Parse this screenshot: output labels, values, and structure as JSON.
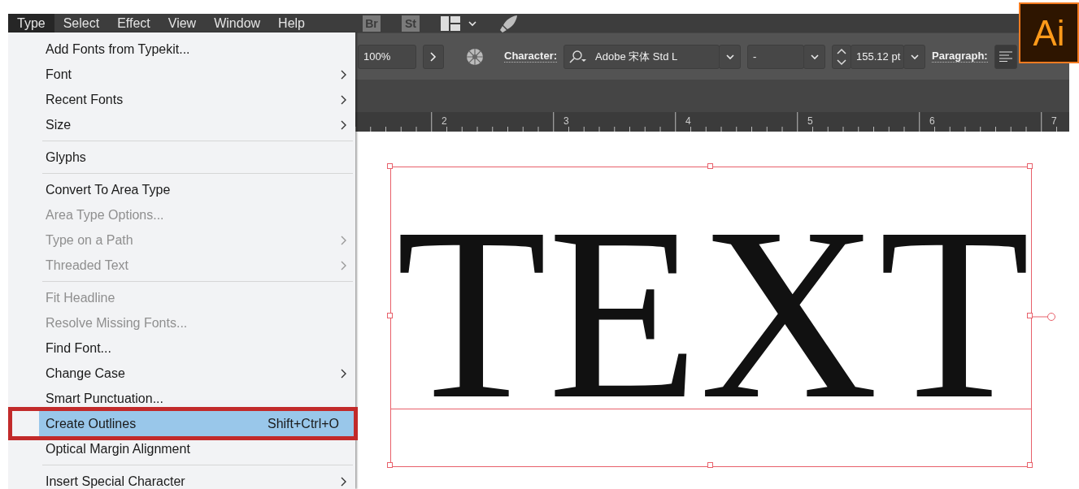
{
  "menu_bar": [
    {
      "label": "Type",
      "selected": true
    },
    {
      "label": "Select",
      "selected": false
    },
    {
      "label": "Effect",
      "selected": false
    },
    {
      "label": "View",
      "selected": false
    },
    {
      "label": "Window",
      "selected": false
    },
    {
      "label": "Help",
      "selected": false
    }
  ],
  "app_buttons": [
    "Br",
    "St"
  ],
  "app_logo": "Ai",
  "control_bar": {
    "zoom": "100%",
    "character_label": "Character:",
    "font": "Adobe 宋体 Std L",
    "style": "-",
    "size": "155.12 pt",
    "paragraph_label": "Paragraph:"
  },
  "ruler": [
    "2",
    "3",
    "4",
    "5",
    "6",
    "7"
  ],
  "type_menu": [
    {
      "kind": "item",
      "label": "Add Fonts from Typekit...",
      "disabled": false,
      "submenu": false,
      "selected": false
    },
    {
      "kind": "item",
      "label": "Font",
      "disabled": false,
      "submenu": true,
      "selected": false
    },
    {
      "kind": "item",
      "label": "Recent Fonts",
      "disabled": false,
      "submenu": true,
      "selected": false
    },
    {
      "kind": "item",
      "label": "Size",
      "disabled": false,
      "submenu": true,
      "selected": false
    },
    {
      "kind": "separator"
    },
    {
      "kind": "item",
      "label": "Glyphs",
      "disabled": false,
      "submenu": false,
      "selected": false
    },
    {
      "kind": "separator"
    },
    {
      "kind": "item",
      "label": "Convert To Area Type",
      "disabled": false,
      "submenu": false,
      "selected": false
    },
    {
      "kind": "item",
      "label": "Area Type Options...",
      "disabled": true,
      "submenu": false,
      "selected": false
    },
    {
      "kind": "item",
      "label": "Type on a Path",
      "disabled": true,
      "submenu": true,
      "selected": false
    },
    {
      "kind": "item",
      "label": "Threaded Text",
      "disabled": true,
      "submenu": true,
      "selected": false
    },
    {
      "kind": "separator"
    },
    {
      "kind": "item",
      "label": "Fit Headline",
      "disabled": true,
      "submenu": false,
      "selected": false
    },
    {
      "kind": "item",
      "label": "Resolve Missing Fonts...",
      "disabled": true,
      "submenu": false,
      "selected": false
    },
    {
      "kind": "item",
      "label": "Find Font...",
      "disabled": false,
      "submenu": false,
      "selected": false
    },
    {
      "kind": "item",
      "label": "Change Case",
      "disabled": false,
      "submenu": true,
      "selected": false
    },
    {
      "kind": "item",
      "label": "Smart Punctuation...",
      "disabled": false,
      "submenu": false,
      "selected": false
    },
    {
      "kind": "item",
      "label": "Create Outlines",
      "shortcut": "Shift+Ctrl+O",
      "disabled": false,
      "submenu": false,
      "selected": true
    },
    {
      "kind": "item",
      "label": "Optical Margin Alignment",
      "disabled": false,
      "submenu": false,
      "selected": false
    },
    {
      "kind": "separator"
    },
    {
      "kind": "item",
      "label": "Insert Special Character",
      "disabled": false,
      "submenu": true,
      "selected": false
    }
  ],
  "artboard": {
    "text": "TEXT"
  }
}
